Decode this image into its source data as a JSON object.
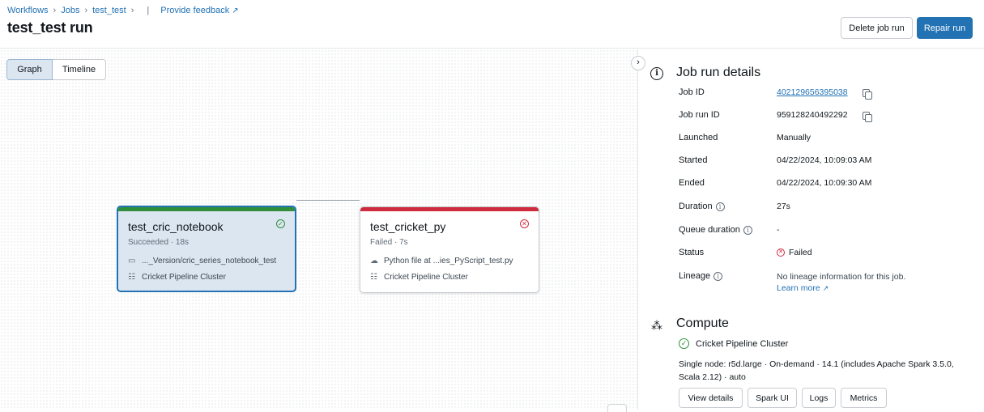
{
  "breadcrumb": {
    "items": [
      "Workflows",
      "Jobs",
      "test_test"
    ],
    "feedback": "Provide feedback"
  },
  "page": {
    "title": "test_test run"
  },
  "header_actions": {
    "delete_label": "Delete job run",
    "repair_label": "Repair run"
  },
  "view_toggle": {
    "graph": "Graph",
    "timeline": "Timeline",
    "active": "Graph"
  },
  "tasks": [
    {
      "name": "test_cric_notebook",
      "status": "Succeeded · 18s",
      "source": "..._Version/cric_series_notebook_test",
      "cluster": "Cricket Pipeline Cluster",
      "state": "success",
      "status_color": "#2f8f3a",
      "selected": true
    },
    {
      "name": "test_cricket_py",
      "status": "Failed · 7s",
      "source": "Python file at   ...ies_PyScript_test.py",
      "cluster": "Cricket Pipeline Cluster",
      "state": "failed",
      "status_color": "#cf2b3e",
      "selected": false
    }
  ],
  "details": {
    "title": "Job run details",
    "rows": [
      {
        "label": "Job ID",
        "value": "402129656395038"
      },
      {
        "label": "Job run ID",
        "value": "959128240492292"
      },
      {
        "label": "Launched",
        "value": "Manually"
      },
      {
        "label": "Started",
        "value": "04/22/2024, 10:09:03 AM"
      },
      {
        "label": "Ended",
        "value": "04/22/2024, 10:09:30 AM"
      },
      {
        "label": "Duration",
        "value": "27s"
      },
      {
        "label": "Queue duration",
        "value": "-"
      },
      {
        "label": "Status",
        "value": "Failed"
      },
      {
        "label": "Lineage",
        "value": "No lineage information for this job."
      }
    ],
    "learn_more": "Learn more"
  },
  "compute": {
    "title": "Compute",
    "cluster_name": "Cricket Pipeline Cluster",
    "description": "Single node: r5d.large · On-demand · 14.1 (includes Apache Spark 3.5.0, Scala 2.12) · auto",
    "buttons": [
      "View details",
      "Spark UI",
      "Logs",
      "Metrics"
    ]
  },
  "colors": {
    "accent": "#2272b4",
    "success": "#2f8f3a",
    "danger": "#cf2b3e"
  },
  "icons": {
    "info": "info-circle-icon",
    "compute": "compute-nodes-icon",
    "copy": "copy-icon",
    "folder": "folder-icon",
    "cloud": "cloud-icon",
    "cluster": "cluster-icon",
    "external": "external-link-icon"
  }
}
